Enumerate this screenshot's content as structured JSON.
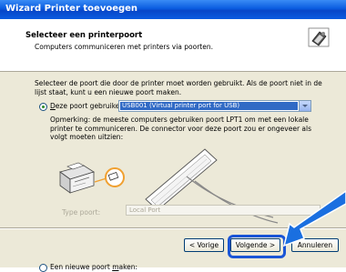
{
  "window": {
    "title": "Wizard Printer toevoegen"
  },
  "header": {
    "title": "Selecteer een printerpoort",
    "subtitle": "Computers communiceren met printers via poorten.",
    "icon": "printer-port-icon"
  },
  "content": {
    "intro": "Selecteer de poort die door de printer moet worden gebruikt. Als de poort niet in de lijst staat, kunt u een nieuwe poort maken.",
    "existing_port_label_underlined": "D",
    "existing_port_label_rest": "eze poort gebruiken:",
    "existing_port_selected": true,
    "port_select_value": "USB001 (Virtual printer port for USB)",
    "note": "Opmerking: de meeste computers gebruiken poort LPT1 om met een lokale printer te communiceren. De connector voor deze poort zou er ongeveer als volgt moeten uitzien:",
    "new_port_label_start": "Een nieuwe poort ",
    "new_port_label_underlined": "m",
    "new_port_label_end": "aken:",
    "port_type_label": "Type poort:",
    "port_type_value": "Local Port"
  },
  "buttons": {
    "back": "< Vorige",
    "next": "Volgende >",
    "cancel": "Annuleren"
  },
  "colors": {
    "titlebar": "#0a5ce0",
    "arrow": "#1a6fe0",
    "highlight": "#1a55d6",
    "usb_circle": "#f0a030"
  }
}
